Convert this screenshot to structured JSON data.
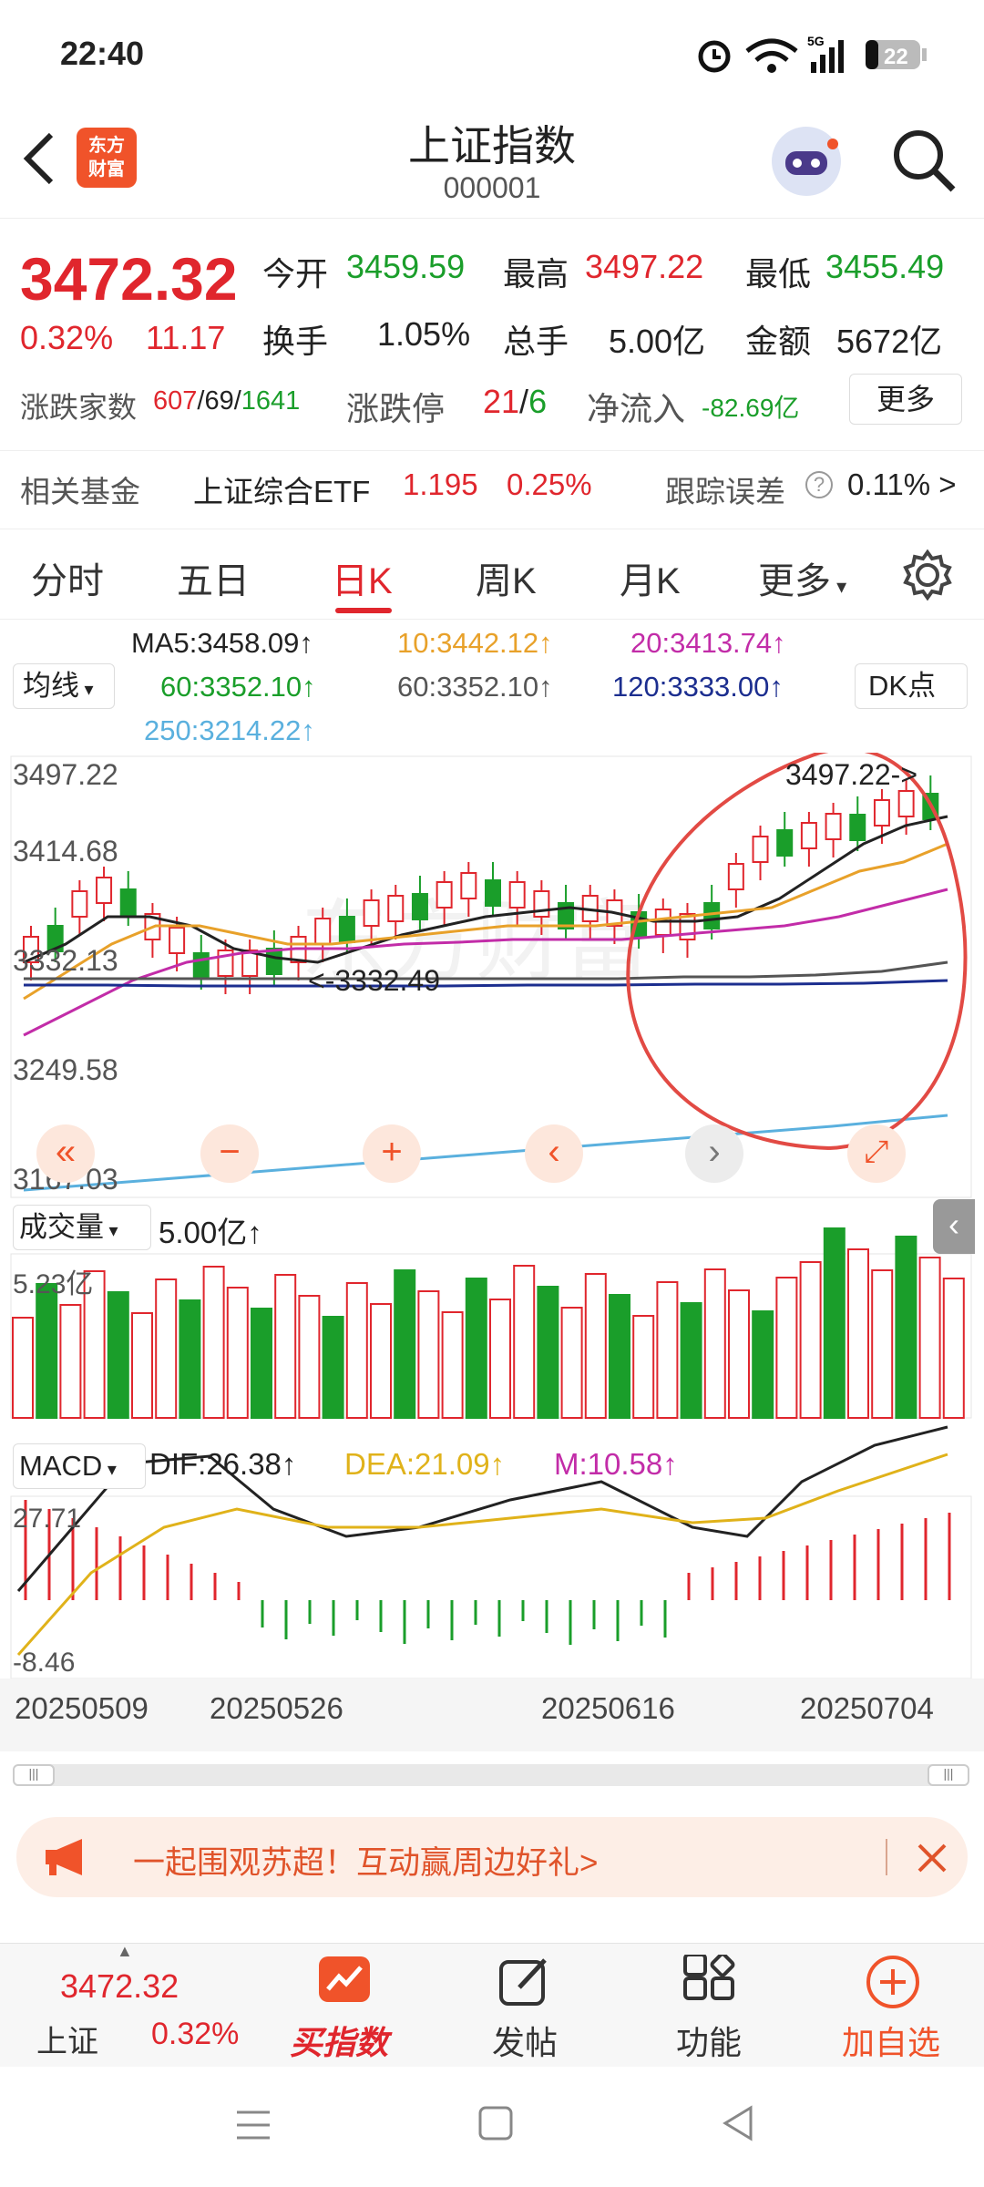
{
  "status": {
    "time": "22:40",
    "battery": "22",
    "signal": "5G"
  },
  "header": {
    "title": "上证指数",
    "code": "000001",
    "logo_line1": "东方",
    "logo_line2": "财富"
  },
  "quote": {
    "price": "3472.32",
    "pct": "0.32%",
    "change": "11.17",
    "open_label": "今开",
    "open": "3459.59",
    "high_label": "最高",
    "high": "3497.22",
    "low_label": "最低",
    "low": "3455.49",
    "turnover_label": "换手",
    "turnover": "1.05%",
    "volume_label": "总手",
    "volume": "5.00亿",
    "amount_label": "金额",
    "amount": "5672亿",
    "breadth_label": "涨跌家数",
    "up": "607",
    "flat": "69",
    "down": "1641",
    "limit_label": "涨跌停",
    "limit_up": "21",
    "limit_down": "6",
    "inflow_label": "净流入",
    "inflow": "-82.69亿",
    "more_button": "更多"
  },
  "fund": {
    "label": "相关基金",
    "name": "上证综合ETF",
    "price": "1.195",
    "pct": "0.25%",
    "err_label": "跟踪误差",
    "err_value": "0.11% >"
  },
  "tabs": [
    "分时",
    "五日",
    "日K",
    "周K",
    "月K",
    "更多"
  ],
  "ma": {
    "selector": "均线",
    "ma5": "MA5:3458.09↑",
    "ma10": "10:3442.12↑",
    "ma20": "20:3413.74↑",
    "ma60a": "60:3352.10↑",
    "ma60b": "60:3352.10↑",
    "ma120": "120:3333.00↑",
    "ma250": "250:3214.22↑",
    "dk": "DK点"
  },
  "kchart": {
    "y_labels": [
      "3497.22",
      "3414.68",
      "3332.13",
      "3249.58",
      "3167.03"
    ],
    "high_note": "3497.22->",
    "low_note": "<-3332.49",
    "watermark": "东方财富"
  },
  "volume": {
    "selector": "成交量",
    "value": "5.00亿↑",
    "max_label": "5.23亿"
  },
  "macd": {
    "selector": "MACD",
    "dif": "DIF:26.38↑",
    "dea": "DEA:21.09↑",
    "m": "M:10.58↑",
    "top_label": "27.71",
    "bottom_label": "-8.46"
  },
  "dates": [
    "20250509",
    "20250526",
    "20250616",
    "20250704"
  ],
  "banner": {
    "text": "一起围观苏超！互动赢周边好礼>"
  },
  "bottom": {
    "index_price": "3472.32",
    "index_name": "上证",
    "index_pct": "0.32%",
    "buy": "买指数",
    "post": "发帖",
    "func": "功能",
    "add": "加自选"
  },
  "colors": {
    "up": "#e0262d",
    "down": "#1a9e2a",
    "accent": "#f0532a"
  }
}
